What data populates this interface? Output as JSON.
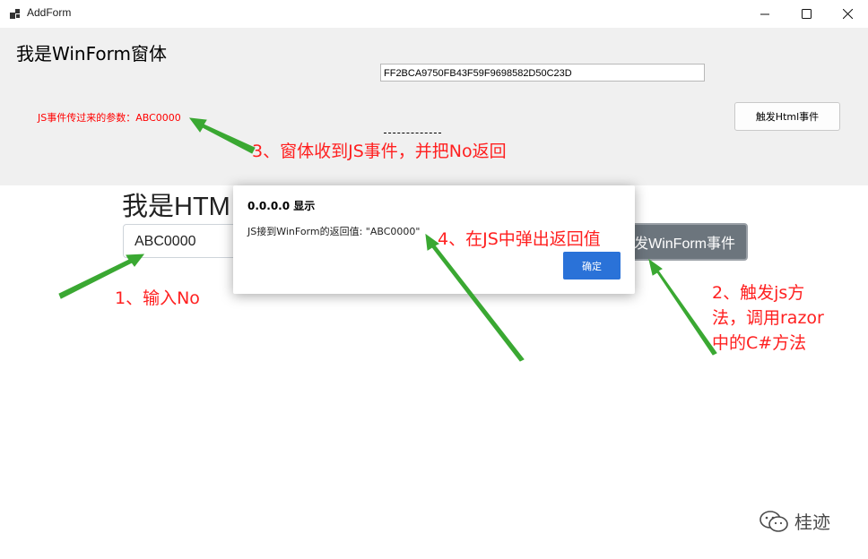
{
  "window": {
    "title": "AddForm",
    "controls": [
      "minimize",
      "maximize",
      "close"
    ]
  },
  "winform": {
    "heading": "我是WinForm窗体",
    "guid_value": "FF2BCA9750FB43F59F9698582D50C23D",
    "param_text": "JS事件传过来的参数：ABC0000",
    "trigger_button": "触发Html事件"
  },
  "web": {
    "heading": "我是HTM",
    "input_value": "ABC0000",
    "trigger_button": "发WinForm事件"
  },
  "dialog": {
    "title": "0.0.0.0 显示",
    "message": "JS接到WinForm的返回值: \"ABC0000\"",
    "ok_button": "确定"
  },
  "annotations": {
    "step1": "1、输入No",
    "step2_line1": "2、触发js方",
    "step2_line2": "法，调用razor",
    "step2_line3": "中的C#方法",
    "step3": "3、窗体收到JS事件，并把No返回",
    "step4": "4、在JS中弹出返回值"
  },
  "watermark": {
    "text": "桂迹",
    "icon": "wechat-icon"
  },
  "colors": {
    "annotation_text": "#ff2020",
    "arrow": "#3aa832",
    "dialog_button": "#2a72d8",
    "web_button": "#6c757d",
    "winform_bg": "#f0f0f0"
  }
}
